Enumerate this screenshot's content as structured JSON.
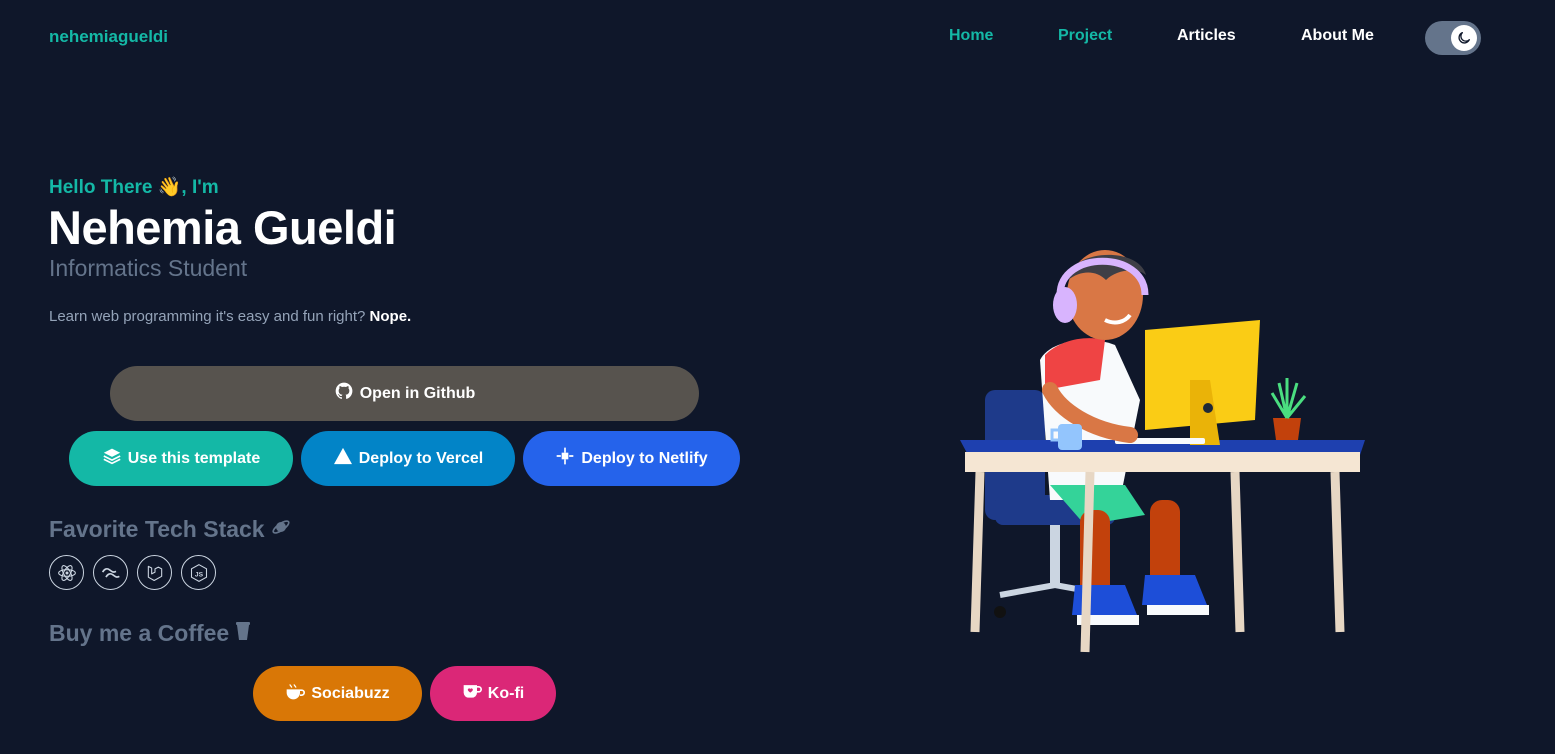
{
  "nav": {
    "brand": "nehemiagueldi",
    "links": [
      {
        "label": "Home"
      },
      {
        "label": "Project"
      },
      {
        "label": "Articles"
      },
      {
        "label": "About Me"
      }
    ]
  },
  "hero": {
    "greeting": "Hello There 👋, I'm",
    "name": "Nehemia Gueldi",
    "role": "Informatics Student",
    "tagline_text": "Learn web programming it's easy and fun right? ",
    "tagline_bold": "Nope."
  },
  "actions": {
    "github": "Open in Github",
    "template": "Use this template",
    "vercel": "Deploy to Vercel",
    "netlify": "Deploy to Netlify"
  },
  "tech_stack": {
    "title": "Favorite Tech Stack",
    "icons": [
      "react-icon",
      "tailwind-icon",
      "laravel-icon",
      "nodejs-icon"
    ]
  },
  "coffee": {
    "title": "Buy me a Coffee",
    "sociabuzz": "Sociabuzz",
    "kofi": "Ko-fi"
  },
  "colors": {
    "background": "#0f172a",
    "accent": "#14b8a6",
    "github_button": "#57534e",
    "vercel_button": "#0284c7",
    "netlify_button": "#2563eb",
    "sociabuzz_button": "#d97706",
    "kofi_button": "#db2777"
  }
}
